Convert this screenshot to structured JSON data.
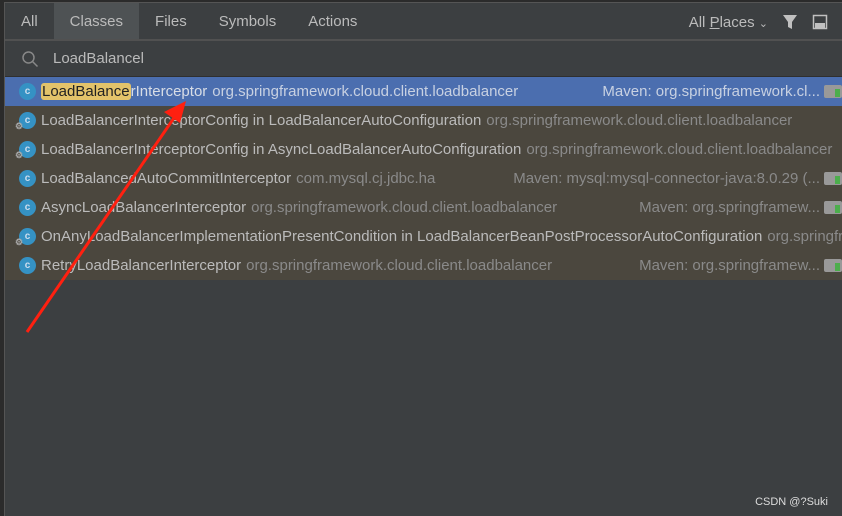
{
  "tabs": [
    "All",
    "Classes",
    "Files",
    "Symbols",
    "Actions"
  ],
  "active_tab": "Classes",
  "scope": {
    "label_pre": "All ",
    "label_u": "P",
    "label_post": "laces"
  },
  "search": {
    "value": "LoadBalancel"
  },
  "results": [
    {
      "highlight": "LoadBalance",
      "name_rest": "rInterceptor",
      "location": "org.springframework.cloud.client.loadbalancer",
      "library": "Maven: org.springframework.cl...",
      "selected": true
    },
    {
      "highlight": "",
      "name_rest": "LoadBalancerInterceptorConfig in LoadBalancerAutoConfiguration",
      "location": "org.springframework.cloud.client.loadbalancer",
      "library": ""
    },
    {
      "highlight": "",
      "name_rest": "LoadBalancerInterceptorConfig in AsyncLoadBalancerAutoConfiguration",
      "location": "org.springframework.cloud.client.loadbalancer",
      "library": ""
    },
    {
      "highlight": "",
      "name_rest": "LoadBalancedAutoCommitInterceptor",
      "location": "com.mysql.cj.jdbc.ha",
      "library": "Maven: mysql:mysql-connector-java:8.0.29 (..."
    },
    {
      "highlight": "",
      "name_rest": "AsyncLoadBalancerInterceptor",
      "location": "org.springframework.cloud.client.loadbalancer",
      "library": "Maven: org.springframew..."
    },
    {
      "highlight": "",
      "name_rest": "OnAnyLoadBalancerImplementationPresentCondition in LoadBalancerBeanPostProcessorAutoConfiguration",
      "location": "org.springframework.cloud.client.loadbalancer",
      "library": ""
    },
    {
      "highlight": "",
      "name_rest": "RetryLoadBalancerInterceptor",
      "location": "org.springframework.cloud.client.loadbalancer",
      "library": "Maven: org.springframew..."
    }
  ],
  "watermark": "CSDN @?Suki",
  "colors": {
    "selection": "#4b6eaf",
    "match_highlight": "#e3c36a",
    "annotation_arrow": "#ff2010"
  }
}
